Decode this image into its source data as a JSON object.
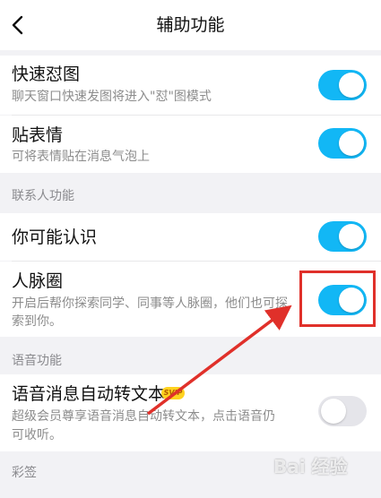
{
  "header": {
    "title": "辅助功能",
    "back_icon": "chevron-left-icon"
  },
  "items": {
    "quick_meme": {
      "title": "快速怼图",
      "desc": "聊天窗口快速发图将进入\"怼\"图模式",
      "enabled": true
    },
    "sticker": {
      "title": "贴表情",
      "desc": "可将表情贴在消息气泡上",
      "enabled": true
    },
    "may_know": {
      "title": "你可能认识",
      "enabled": true
    },
    "network": {
      "title": "人脉圈",
      "desc_line1": "开启后帮你探索同学、同事等人脉圈，他们也可探",
      "desc_line2": "索到你。",
      "enabled": true
    },
    "voice_to_text": {
      "title": "语音消息自动转文本",
      "badge": "SVIP",
      "desc_line1": "超级会员尊享语音消息自动转文本，点击语音仍",
      "desc_line2": "可收听。",
      "enabled": false
    }
  },
  "sections": {
    "contacts": "联系人功能",
    "voice": "语音功能",
    "stickers": "彩签"
  },
  "watermark": "Bai 经验",
  "colors": {
    "toggle_on": "#12b7f5",
    "toggle_off": "#e5e5ea",
    "annotation": "#e0302a",
    "badge": "#ffd21f"
  }
}
